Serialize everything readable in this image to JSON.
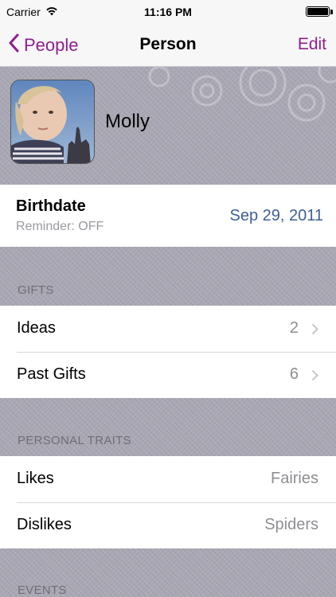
{
  "status_bar": {
    "carrier": "Carrier",
    "time": "11:16 PM"
  },
  "nav": {
    "back_label": "People",
    "title": "Person",
    "edit_label": "Edit"
  },
  "person": {
    "name": "Molly"
  },
  "birthdate": {
    "title": "Birthdate",
    "reminder": "Reminder: OFF",
    "date": "Sep 29, 2011"
  },
  "sections": {
    "gifts": {
      "header": "GIFTS",
      "rows": [
        {
          "label": "Ideas",
          "count": "2"
        },
        {
          "label": "Past Gifts",
          "count": "6"
        }
      ]
    },
    "traits": {
      "header": "PERSONAL TRAITS",
      "rows": [
        {
          "label": "Likes",
          "value": "Fairies"
        },
        {
          "label": "Dislikes",
          "value": "Spiders"
        }
      ]
    },
    "events": {
      "header": "EVENTS"
    }
  },
  "colors": {
    "accent": "#8e1f8f",
    "date_blue": "#3f5f94",
    "secondary_gray": "#8e8e93"
  }
}
